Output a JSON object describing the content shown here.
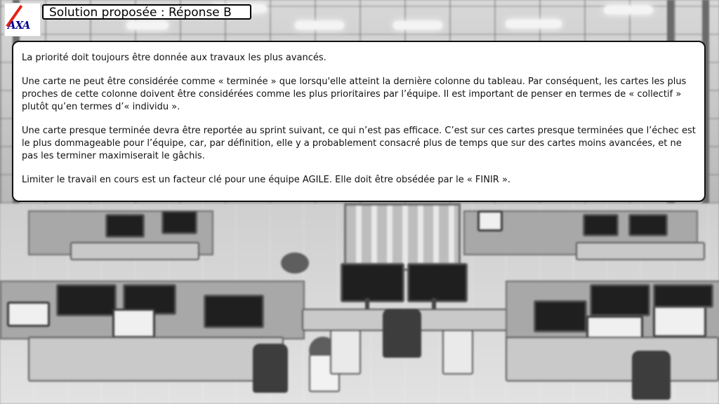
{
  "logo": {
    "text": "AXA"
  },
  "header": {
    "title": "Solution proposée : Réponse B"
  },
  "card": {
    "paragraphs": [
      "La priorité doit toujours être donnée aux travaux les plus avancés.",
      "Une carte ne peut être considérée comme « terminée » que lorsqu'elle atteint la dernière colonne du tableau. Par conséquent, les cartes les plus proches de cette colonne doivent être considérées comme les plus prioritaires par l’équipe. Il est important de penser en termes de « collectif » plutôt qu’en termes d’« individu ».",
      "Une carte presque terminée devra être reportée au sprint suivant, ce qui n’est pas efficace. C’est sur ces cartes presque terminées que l’échec est le plus dommageable pour l’équipe, car, par définition, elle y a probablement consacré plus de temps que sur des cartes moins avancées, et ne pas les terminer maximiserait le gâchis.",
      "Limiter le travail en cours est un facteur clé pour une équipe AGILE. Elle doit être obsédée par le « FINIR »."
    ]
  },
  "colors": {
    "logo_blue": "#00008f",
    "logo_red": "#e2231a",
    "border": "#111111"
  }
}
